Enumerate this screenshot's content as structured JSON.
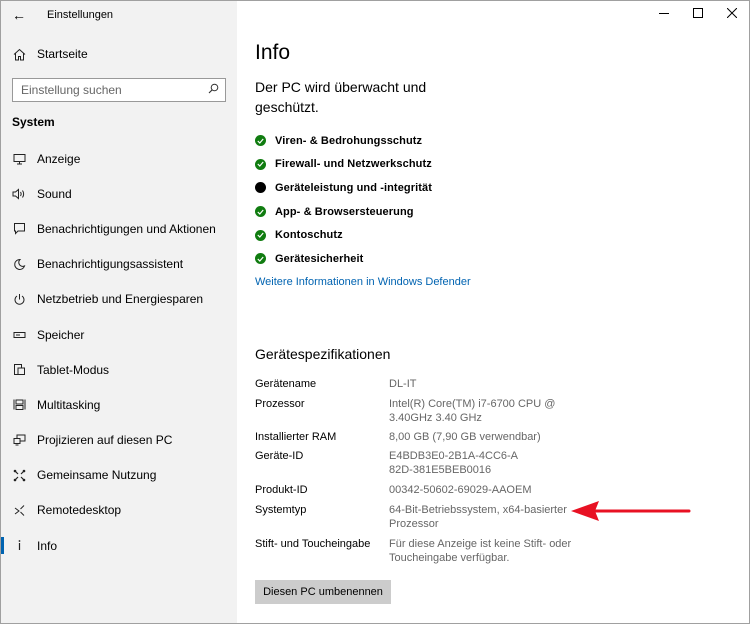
{
  "window": {
    "title": "Einstellungen",
    "controls": {
      "minimize": "—",
      "maximize": "☐",
      "close": "✕"
    }
  },
  "sidebar": {
    "home_label": "Startseite",
    "search": {
      "placeholder": "Einstellung suchen",
      "value": ""
    },
    "section_label": "System",
    "items": [
      {
        "label": "Anzeige",
        "icon": "monitor-icon"
      },
      {
        "label": "Sound",
        "icon": "speaker-icon"
      },
      {
        "label": "Benachrichtigungen und Aktionen",
        "icon": "notification-icon"
      },
      {
        "label": "Benachrichtigungsassistent",
        "icon": "moon-icon"
      },
      {
        "label": "Netzbetrieb und Energiesparen",
        "icon": "power-icon"
      },
      {
        "label": "Speicher",
        "icon": "storage-icon"
      },
      {
        "label": "Tablet-Modus",
        "icon": "tablet-mode-icon"
      },
      {
        "label": "Multitasking",
        "icon": "multitasking-icon"
      },
      {
        "label": "Projizieren auf diesen PC",
        "icon": "project-icon"
      },
      {
        "label": "Gemeinsame Nutzung",
        "icon": "share-icon"
      },
      {
        "label": "Remotedesktop",
        "icon": "remote-desktop-icon"
      },
      {
        "label": "Info",
        "icon": "info-icon",
        "active": true
      }
    ]
  },
  "main": {
    "title": "Info",
    "status_heading": "Der PC wird überwacht und geschützt.",
    "checks": [
      {
        "label": "Viren- & Bedrohungsschutz",
        "status": "ok",
        "color": "#107c10"
      },
      {
        "label": "Firewall- und Netzwerkschutz",
        "status": "ok",
        "color": "#107c10"
      },
      {
        "label": "Geräteleistung und -integrität",
        "status": "info",
        "color": "#000000"
      },
      {
        "label": "App- & Browsersteuerung",
        "status": "ok",
        "color": "#107c10"
      },
      {
        "label": "Kontoschutz",
        "status": "ok",
        "color": "#107c10"
      },
      {
        "label": "Gerätesicherheit",
        "status": "ok",
        "color": "#107c10"
      }
    ],
    "defender_link": "Weitere Informationen in Windows Defender",
    "specs_heading": "Gerätespezifikationen",
    "specs": [
      {
        "key": "Gerätename",
        "value": "DL-IT"
      },
      {
        "key": "Prozessor",
        "value": "Intel(R) Core(TM) i7-6700 CPU @ 3.40GHz   3.40 GHz"
      },
      {
        "key": "Installierter RAM",
        "value": "8,00 GB (7,90 GB verwendbar)"
      },
      {
        "key": "Geräte-ID",
        "value": "E4BDB3E0-2B1A-4CC6-A82D-381E5BEB0016"
      },
      {
        "key": "Produkt-ID",
        "value": "00342-50602-69029-AAOEM"
      },
      {
        "key": "Systemtyp",
        "value": "64-Bit-Betriebssystem, x64-basierter Prozessor"
      },
      {
        "key": "Stift- und Toucheingabe",
        "value": "Für diese Anzeige ist keine Stift- oder Toucheingabe verfügbar."
      }
    ],
    "rename_button": "Diesen PC umbenennen"
  },
  "colors": {
    "accent": "#0063b1",
    "sidebar_bg": "#f2f2f2",
    "annotation_arrow": "#e81123"
  }
}
